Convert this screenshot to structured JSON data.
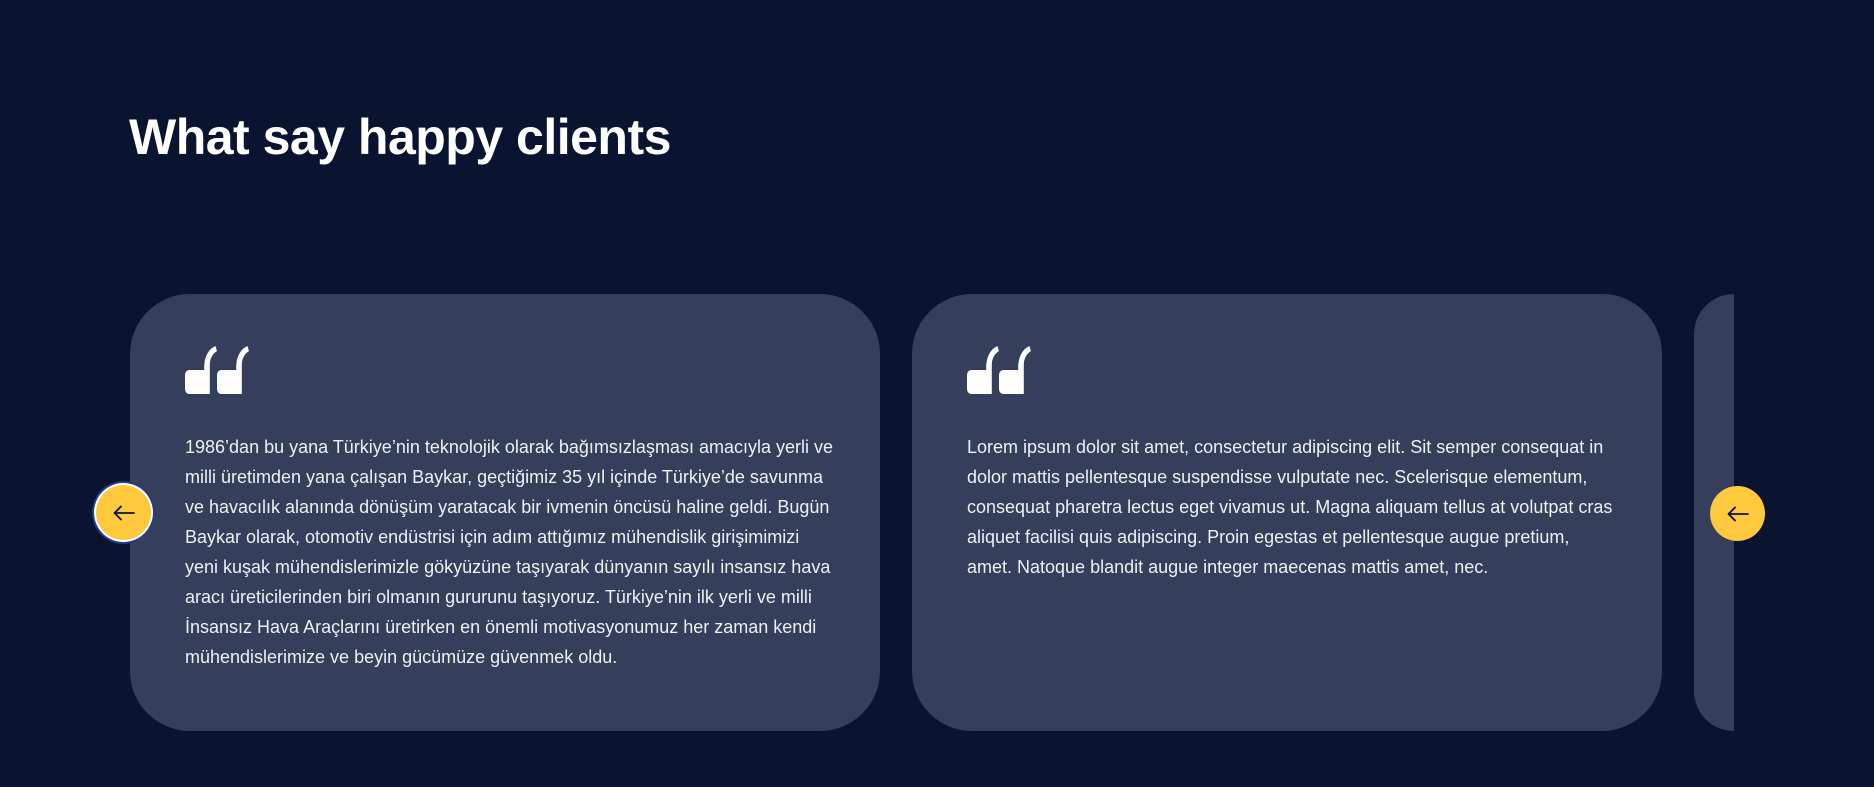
{
  "section": {
    "title": "What say happy clients"
  },
  "testimonials": [
    {
      "text": "1986’dan bu yana Türkiye’nin teknolojik olarak bağımsızlaşması amacıyla yerli ve milli üretimden yana çalışan Baykar, geçtiğimiz 35 yıl içinde Türkiye’de savunma ve havacılık alanında dönüşüm yaratacak bir ivmenin öncüsü haline geldi. Bugün Baykar olarak, otomotiv endüstrisi için adım attığımız mühendislik girişimimizi yeni kuşak mühendislerimizle gökyüzüne taşıyarak dünyanın sayılı insansız hava aracı üreticilerinden biri olmanın gururunu taşıyoruz. Türkiye’nin ilk yerli ve milli İnsansız Hava Araçlarını üretirken en önemli motivasyonumuz her zaman kendi mühendislerimize ve beyin gücümüze güvenmek oldu.",
      "icon": "quote-icon"
    },
    {
      "text": "Lorem ipsum dolor sit amet, consectetur adipiscing elit. Sit semper consequat in dolor mattis pellentesque suspendisse vulputate nec. Scelerisque elementum, consequat pharetra lectus eget vivamus ut. Magna aliquam tellus at volutpat cras aliquet facilisi quis adipiscing. Proin egestas et pellentesque augue pretium, amet. Natoque blandit augue integer maecenas mattis amet, nec.",
      "icon": "quote-icon"
    }
  ],
  "navigation": {
    "prev_icon": "arrow-left-icon",
    "next_icon": "arrow-left-icon"
  },
  "colors": {
    "background": "#0a1330",
    "card": "#353f5b",
    "accent": "#ffc83d",
    "text": "#ffffff"
  }
}
